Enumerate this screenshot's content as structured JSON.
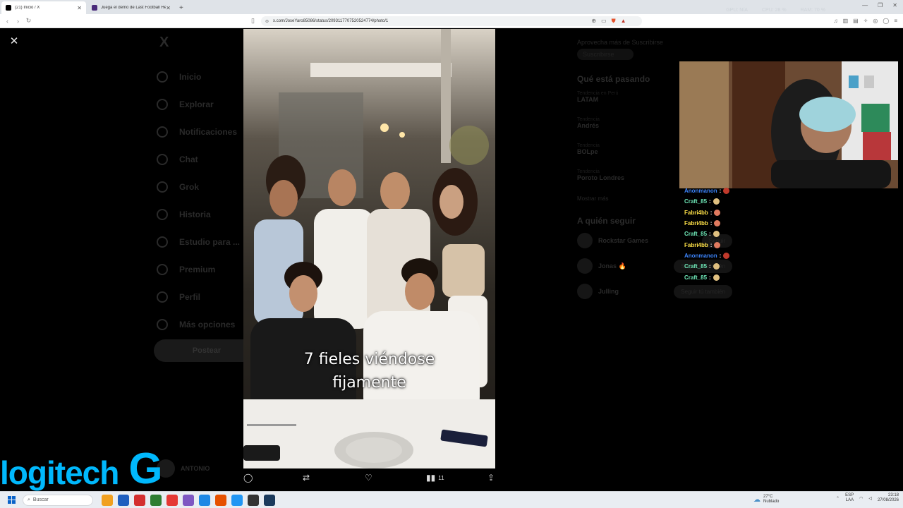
{
  "browser": {
    "tabs": [
      {
        "title": "(21) Inicio / X",
        "active": true,
        "favicon_color": "#000000"
      },
      {
        "title": "Juega el demo de Last Football Hero",
        "active": false,
        "favicon_color": "#4a2b7a"
      }
    ],
    "new_tab": "+",
    "url": "x.com/JoseYaro85086/status/2093117707520524774/photo/1",
    "window_controls": {
      "minimize": "—",
      "maximize": "❐",
      "close": "✕"
    },
    "sys_stats": [
      "GPU: N/A",
      "CPU: 28 %",
      "RAM: 70 %"
    ]
  },
  "x_page": {
    "logo": "X",
    "nav": [
      "Inicio",
      "Explorar",
      "Notificaciones",
      "Chat",
      "Grok",
      "Historia",
      "Estudio para ...",
      "Premium",
      "Perfil",
      "Más opciones"
    ],
    "post_button": "Postear",
    "profile_name": "ANTONIO",
    "right_top_line": "Aprovecha más de Suscribirse",
    "right_top_sub": "Suscribirse",
    "trending_header": "Qué está pasando",
    "trends": [
      {
        "context": "Tendencia en Perú",
        "name": "LATAM"
      },
      {
        "context": "Tendencia",
        "name": "Andrés"
      },
      {
        "context": "Tendencia",
        "name": "BOLpe"
      },
      {
        "context": "Tendencia",
        "name": "Poroto Londres"
      }
    ],
    "show_more": "Mostrar más",
    "who_to_follow_header": "A quién seguir",
    "follow_suggestions": [
      {
        "name": "Rockstar Games",
        "button": "Seguir"
      },
      {
        "name": "Jonas 🔥",
        "button": "Seguir tú también"
      },
      {
        "name": "Julling",
        "button": "Seguir tú también"
      }
    ]
  },
  "viewer": {
    "close": "✕",
    "caption_line1": "7 fieles viéndose",
    "caption_line2": "fijamente",
    "actions": {
      "reply_icon": "reply-icon",
      "repost_icon": "repost-icon",
      "like_icon": "heart-icon",
      "views_icon": "views-icon",
      "views_count": "11",
      "share_icon": "share-icon"
    }
  },
  "stream_overlay": {
    "chat": [
      {
        "user": "Anonmanon",
        "color": "#3b82f6",
        "emote": "#c0392b"
      },
      {
        "user": "Craft_85",
        "color": "#6ee7b7",
        "emote": "#e0c080"
      },
      {
        "user": "Fabri4bb",
        "color": "#fde047",
        "emote": "#e07a5f"
      },
      {
        "user": "Fabri4bb",
        "color": "#fde047",
        "emote": "#e07a5f"
      },
      {
        "user": "Craft_85",
        "color": "#6ee7b7",
        "emote": "#e0c080"
      },
      {
        "user": "Fabri4bb",
        "color": "#fde047",
        "emote": "#e07a5f"
      },
      {
        "user": "Anonmanon",
        "color": "#3b82f6",
        "emote": "#c0392b"
      },
      {
        "user": "Craft_85",
        "color": "#6ee7b7",
        "emote": "#e0c080"
      },
      {
        "user": "Craft_85",
        "color": "#6ee7b7",
        "emote": "#e0c080"
      }
    ],
    "separator": ":",
    "watermark_word": "logitech",
    "watermark_letter": "G"
  },
  "taskbar": {
    "search_placeholder": "Buscar",
    "apps": [
      "#f0a020",
      "#1f5fbf",
      "#d32f2f",
      "#2e7d32",
      "#e53935",
      "#7e57c2",
      "#1e88e5",
      "#e65100",
      "#2196f3",
      "#333333",
      "#1b3a5c"
    ],
    "weather_temp": "27°C",
    "weather_desc": "Nublado",
    "lang": "ESP",
    "lang_sub": "LAA",
    "time": "23:18",
    "date": "27/08/2026"
  }
}
